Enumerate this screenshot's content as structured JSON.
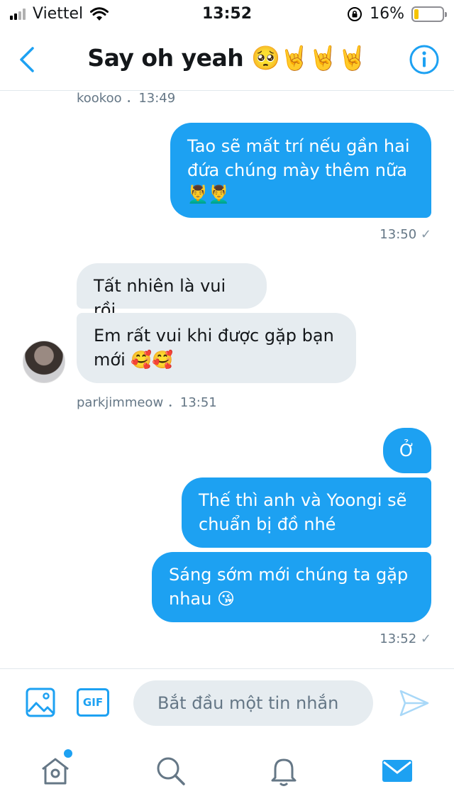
{
  "status": {
    "carrier": "Viettel",
    "time": "13:52",
    "battery": "16%",
    "battery_level": 0.16
  },
  "header": {
    "title": "Say oh yeah 🥺🤘🤘🤘"
  },
  "messages": {
    "m0_meta": "kookoo ．13:49",
    "m1_text": "Tao sẽ mất trí nếu gần hai đứa chúng mày thêm nữa 💆‍♂️💆‍♂️",
    "m1_time": "13:50",
    "m2_text": "Tất nhiên là vui rồi",
    "m3_text": "Em rất vui khi được gặp bạn mới 🥰🥰",
    "m3_meta": "parkjimmeow ．13:51",
    "m4_text": "Ở",
    "m5_text": "Thế thì anh và Yoongi sẽ chuẩn bị đồ nhé",
    "m6_text": "Sáng sớm mới chúng ta gặp nhau 😘",
    "m6_time": "13:52"
  },
  "composer": {
    "gif_label": "GIF",
    "placeholder": "Bắt đầu một tin nhắn"
  },
  "colors": {
    "accent": "#1da1f2",
    "incoming_bubble": "#e6ecf0",
    "meta_text": "#657786"
  },
  "icons": {
    "back": "chevron-left-icon",
    "info": "info-icon",
    "media": "image-icon",
    "send": "send-icon",
    "home": "home-icon",
    "search": "search-icon",
    "notifications": "bell-icon",
    "messages": "mail-icon"
  }
}
